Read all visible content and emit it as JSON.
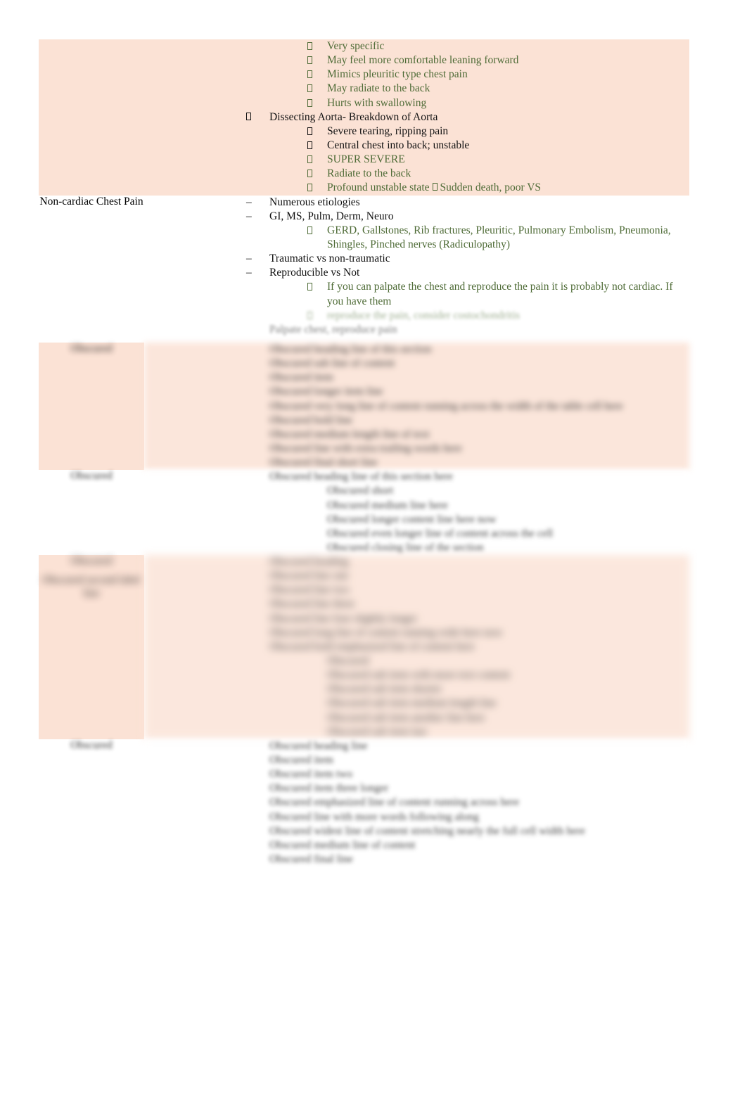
{
  "document": {
    "type": "study-notes-table",
    "page_background": "#ffffff",
    "highlight_color": "#fbe2d5",
    "green_text_color": "#4e6b36",
    "black_text_color": "#111111"
  },
  "rows": [
    {
      "id": "pericarditis-aorta",
      "shaded": true,
      "label": "",
      "items": [
        {
          "level": 2,
          "marker": "tofu-bullet",
          "color": "green",
          "text": "Very specific"
        },
        {
          "level": 2,
          "marker": "tofu-bullet",
          "color": "green",
          "text": "May feel more comfortable leaning forward"
        },
        {
          "level": 2,
          "marker": "tofu-bullet",
          "color": "green",
          "text": "Mimics pleuritic type chest pain"
        },
        {
          "level": 2,
          "marker": "tofu-bullet",
          "color": "green",
          "text": "May radiate to the back"
        },
        {
          "level": 2,
          "marker": "tofu-bullet",
          "color": "green",
          "text": "Hurts with swallowing"
        },
        {
          "level": 1,
          "marker": "tofu-bullet",
          "color": "black",
          "text": "Dissecting Aorta- Breakdown of Aorta"
        },
        {
          "level": 2,
          "marker": "tofu-bullet",
          "color": "black",
          "text": "Severe tearing, ripping pain"
        },
        {
          "level": 2,
          "marker": "tofu-bullet",
          "color": "black",
          "text": "Central chest into back; unstable"
        },
        {
          "level": 2,
          "marker": "tofu-bullet",
          "color": "green",
          "text": "SUPER SEVERE"
        },
        {
          "level": 2,
          "marker": "tofu-bullet",
          "color": "green",
          "text": "Radiate to the back"
        },
        {
          "level": 2,
          "marker": "tofu-bullet",
          "color": "green",
          "text_before_arrow": "Profound unstable state",
          "text_after_arrow": "Sudden death, poor VS"
        }
      ]
    },
    {
      "id": "non-cardiac-chest-pain",
      "shaded": false,
      "label": "Non-cardiac Chest Pain",
      "items": [
        {
          "level": 1,
          "marker": "dash",
          "color": "black",
          "text": "Numerous etiologies"
        },
        {
          "level": 1,
          "marker": "dash",
          "color": "black",
          "text": "GI, MS, Pulm, Derm, Neuro"
        },
        {
          "level": 2,
          "marker": "tofu-bullet",
          "color": "green",
          "text": "GERD, Gallstones, Rib fractures, Pleuritic, Pulmonary Embolism, Pneumonia, Shingles, Pinched nerves (Radiculopathy)"
        },
        {
          "level": 1,
          "marker": "dash",
          "color": "black",
          "text": "Traumatic vs non-traumatic"
        },
        {
          "level": 1,
          "marker": "dash",
          "color": "black",
          "text": "Reproducible vs Not"
        },
        {
          "level": 2,
          "marker": "tofu-bullet",
          "color": "green",
          "text": "If you can palpate the chest and reproduce the pain it is probably not cardiac. If you have them"
        }
      ],
      "obscured_tail": {
        "blurred": true,
        "lines": [
          {
            "level": 2,
            "color": "green",
            "text": "reproduce the pain, consider costochondritis"
          },
          {
            "level": 1,
            "color": "black",
            "text": "Palpate chest, reproduce pain"
          }
        ]
      }
    },
    {
      "id": "redacted-row-1",
      "shaded": true,
      "blurred": true,
      "label": "Obscured",
      "lines": [
        {
          "level": 1,
          "color": "black",
          "text": "Obscured heading line of this section"
        },
        {
          "level": 2,
          "color": "black",
          "text": "Obscured sub line of content"
        },
        {
          "level": 1,
          "color": "black",
          "text": "Obscured item"
        },
        {
          "level": 1,
          "color": "black",
          "text": "Obscured longer item line"
        },
        {
          "level": 1,
          "color": "black",
          "text": "Obscured very long line of content running across the width of the table cell here"
        },
        {
          "level": 1,
          "color": "black",
          "text": "Obscured bold line"
        },
        {
          "level": 1,
          "color": "black",
          "text": "Obscured medium length line of text"
        },
        {
          "level": 1,
          "color": "black",
          "text": "Obscured line with extra trailing words here"
        },
        {
          "level": 1,
          "color": "black",
          "text": "Obscured final short line"
        }
      ]
    },
    {
      "id": "redacted-row-2",
      "shaded": false,
      "blurred": true,
      "label": "Obscured",
      "lines": [
        {
          "level": 1,
          "color": "black",
          "text": "Obscured heading line of this section here"
        },
        {
          "level": 2,
          "color": "black",
          "text": "Obscured short"
        },
        {
          "level": 2,
          "color": "black",
          "text": "Obscured medium line here"
        },
        {
          "level": 2,
          "color": "black",
          "text": "Obscured longer content line here now"
        },
        {
          "level": 2,
          "color": "black",
          "text": "Obscured even longer line of content across the cell"
        },
        {
          "level": 2,
          "color": "black",
          "text": "Obscured closing line of the section"
        }
      ]
    },
    {
      "id": "redacted-row-3",
      "shaded": true,
      "blurred": true,
      "label": "Obscured",
      "label_sub": "Obscured second label line",
      "lines": [
        {
          "level": 1,
          "color": "black",
          "text": "Obscured heading"
        },
        {
          "level": 1,
          "color": "black",
          "text": "Obscured line one"
        },
        {
          "level": 1,
          "color": "black",
          "text": "Obscured line two"
        },
        {
          "level": 1,
          "color": "black",
          "text": "Obscured line three"
        },
        {
          "level": 1,
          "color": "black",
          "text": "Obscured line four slightly longer"
        },
        {
          "level": 1,
          "color": "black",
          "text": "Obscured long line of content running wide here now"
        },
        {
          "level": 1,
          "color": "black",
          "text": "Obscured bold emphasized line of content here"
        },
        {
          "level": 3,
          "color": "black",
          "text": "Obscured"
        },
        {
          "level": 3,
          "color": "black",
          "text": "Obscured sub item with more text content"
        },
        {
          "level": 3,
          "color": "black",
          "text": "Obscured sub item shorter"
        },
        {
          "level": 3,
          "color": "black",
          "text": "Obscured sub item medium length line"
        },
        {
          "level": 3,
          "color": "black",
          "text": "Obscured sub item another line here"
        },
        {
          "level": 3,
          "color": "black",
          "text": "Obscured sub item last"
        }
      ]
    },
    {
      "id": "redacted-row-4",
      "shaded": false,
      "blurred": true,
      "label": "Obscured",
      "lines": [
        {
          "level": 1,
          "color": "black",
          "text": "Obscured heading line"
        },
        {
          "level": 1,
          "color": "black",
          "text": "Obscured item"
        },
        {
          "level": 1,
          "color": "black",
          "text": "Obscured item two"
        },
        {
          "level": 1,
          "color": "black",
          "text": "Obscured item three longer"
        },
        {
          "level": 1,
          "color": "black",
          "text": "Obscured emphasized line of content running across here"
        },
        {
          "level": 1,
          "color": "black",
          "text": "Obscured line with more words following along"
        },
        {
          "level": 1,
          "color": "black",
          "text": "Obscured widest line of content stretching nearly the full cell width here"
        },
        {
          "level": 1,
          "color": "black",
          "text": "Obscured medium line of content"
        },
        {
          "level": 1,
          "color": "black",
          "text": "Obscured final line"
        }
      ]
    }
  ]
}
